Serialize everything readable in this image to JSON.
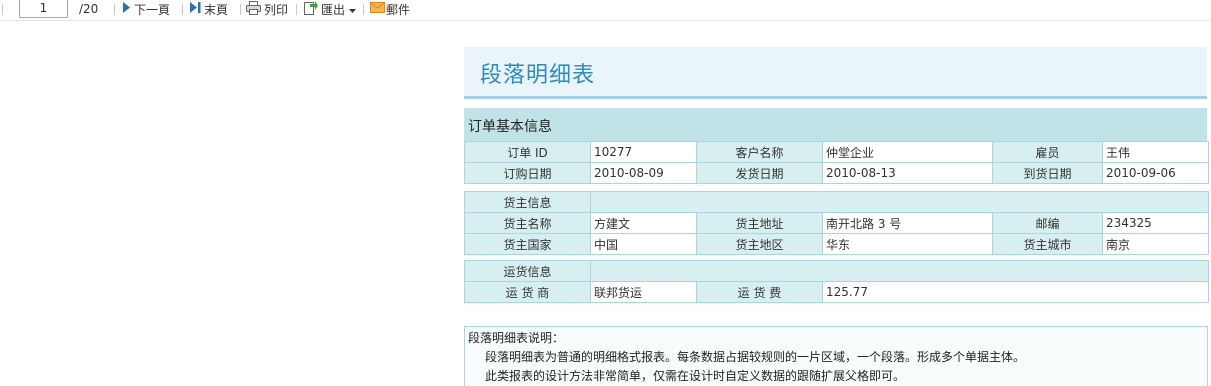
{
  "toolbar": {
    "page_value": "1",
    "page_total": "/20",
    "next_label": "下一頁",
    "last_label": "末頁",
    "print_label": "列印",
    "export_label": "匯出",
    "mail_label": "郵件",
    "icons": [
      "next-arrow-icon",
      "last-page-icon",
      "printer-icon",
      "export-icon",
      "mail-icon"
    ],
    "colors": {
      "arrow": "#2e6fb7",
      "export": "#3aa53a",
      "mail": "#f0a030"
    }
  },
  "report": {
    "title": "段落明细表",
    "section_title": "订单基本信息",
    "order_block": [
      [
        {
          "label": "订单  ID",
          "value": "10277"
        },
        {
          "label": "客户名称",
          "value": "仲堂企业"
        },
        {
          "label": "雇员",
          "value": "王伟"
        }
      ],
      [
        {
          "label": "订购日期",
          "value": "2010-08-09"
        },
        {
          "label": "发货日期",
          "value": "2010-08-13"
        },
        {
          "label": "到货日期",
          "value": "2010-09-06"
        }
      ]
    ],
    "shipper_block": {
      "heading": "货主信息",
      "rows": [
        [
          {
            "label": "货主名称",
            "value": "方建文"
          },
          {
            "label": "货主地址",
            "value": "南开北路 3 号"
          },
          {
            "label": "邮编",
            "value": "234325"
          }
        ],
        [
          {
            "label": "货主国家",
            "value": "中国"
          },
          {
            "label": "货主地区",
            "value": "华东"
          },
          {
            "label": "货主城市",
            "value": "南京"
          }
        ]
      ]
    },
    "freight_block": {
      "heading": "运货信息",
      "row": [
        {
          "label": "运 货 商",
          "value": "联邦货运"
        },
        {
          "label": "运 货 费",
          "value": "125.77"
        }
      ]
    },
    "notes": {
      "heading": "段落明细表说明：",
      "lines": [
        "段落明细表为普通的明细格式报表。每条数据占据较规则的一片区域，一个段落。形成多个单据主体。",
        "此类报表的设计方法非常简单，仅需在设计时自定义数据的跟随扩展父格即可。"
      ]
    },
    "colors": {
      "title": "#2e8bc2",
      "header_bg": "#eaf5fb",
      "section_bg": "#bfe3e6",
      "label_bg": "#d7eff0",
      "border": "#a8d5df"
    }
  }
}
